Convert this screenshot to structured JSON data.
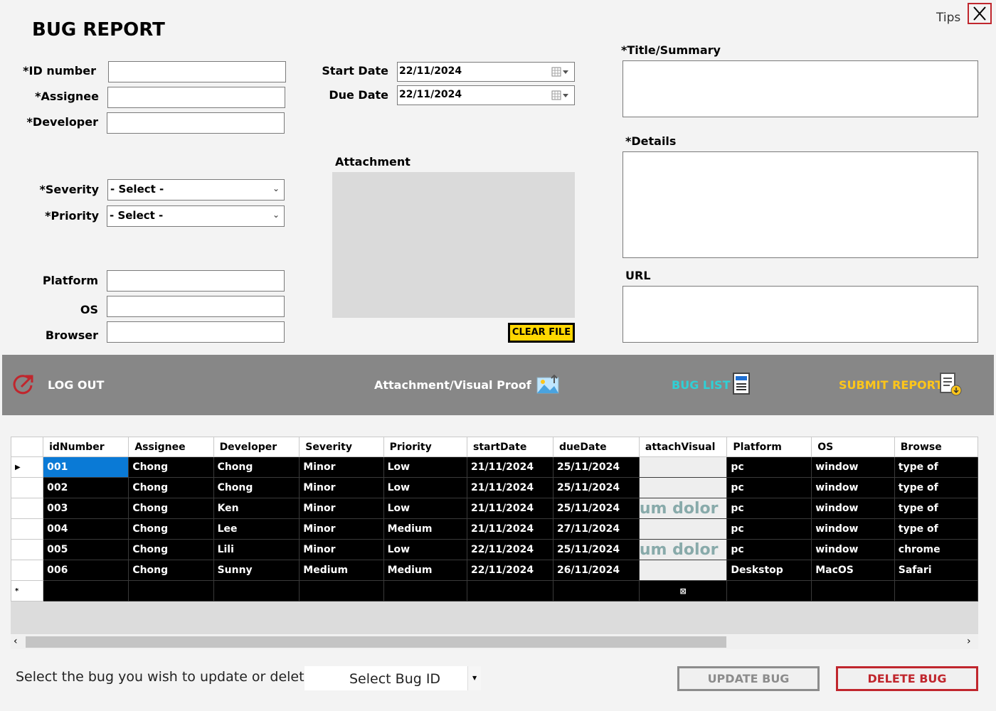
{
  "window": {
    "title": "BUG REPORT",
    "tips": "Tips"
  },
  "form": {
    "id_label": "*ID number",
    "assignee_label": "*Assignee",
    "developer_label": "*Developer",
    "severity_label": "*Severity",
    "priority_label": "*Priority",
    "platform_label": "Platform",
    "os_label": "OS",
    "browser_label": "Browser",
    "severity_value": "- Select -",
    "priority_value": "- Select -",
    "start_label": "Start Date",
    "due_label": "Due Date",
    "start_value": "22/11/2024",
    "due_value": "22/11/2024",
    "attachment_label": "Attachment",
    "clear_file": "CLEAR FILE",
    "title_label": "*Title/Summary",
    "details_label": "*Details",
    "url_label": "URL"
  },
  "toolbar": {
    "logout": "LOG OUT",
    "attachment": "Attachment/Visual Proof",
    "bug_list": "BUG LIST",
    "submit": "SUBMIT REPORT",
    "colors": {
      "bg": "#878787",
      "bug_list": "#2fd0d6",
      "submit": "#ffc61a",
      "logout_icon": "#c0262d"
    }
  },
  "grid": {
    "columns": [
      "idNumber",
      "Assignee",
      "Developer",
      "Severity",
      "Priority",
      "startDate",
      "dueDate",
      "attachVisual",
      "Platform",
      "OS",
      "Browse"
    ],
    "rows": [
      [
        "001",
        "Chong",
        "Chong",
        "Minor",
        "Low",
        "21/11/2024",
        "25/11/2024",
        "",
        "pc",
        "window",
        "type of"
      ],
      [
        "002",
        "Chong",
        "Chong",
        "Minor",
        "Low",
        "21/11/2024",
        "25/11/2024",
        "",
        "pc",
        "window",
        "type of"
      ],
      [
        "003",
        "Chong",
        "Ken",
        "Minor",
        "Low",
        "21/11/2024",
        "25/11/2024",
        "um dolor",
        "pc",
        "window",
        "type of"
      ],
      [
        "004",
        "Chong",
        "Lee",
        "Minor",
        "Medium",
        "21/11/2024",
        "27/11/2024",
        "",
        "pc",
        "window",
        "type of"
      ],
      [
        "005",
        "Chong",
        "Lili",
        "Minor",
        "Low",
        "22/11/2024",
        "25/11/2024",
        "um dolor",
        "pc",
        "window",
        "chrome"
      ],
      [
        "006",
        "Chong",
        "Sunny",
        "Medium",
        "Medium",
        "22/11/2024",
        "26/11/2024",
        "",
        "Deskstop",
        "MacOS",
        "Safari"
      ]
    ]
  },
  "bottom": {
    "prompt": "Select the bug you wish to update or delete -",
    "select_bug": "Select Bug ID",
    "update": "UPDATE BUG",
    "delete": "DELETE BUG"
  }
}
